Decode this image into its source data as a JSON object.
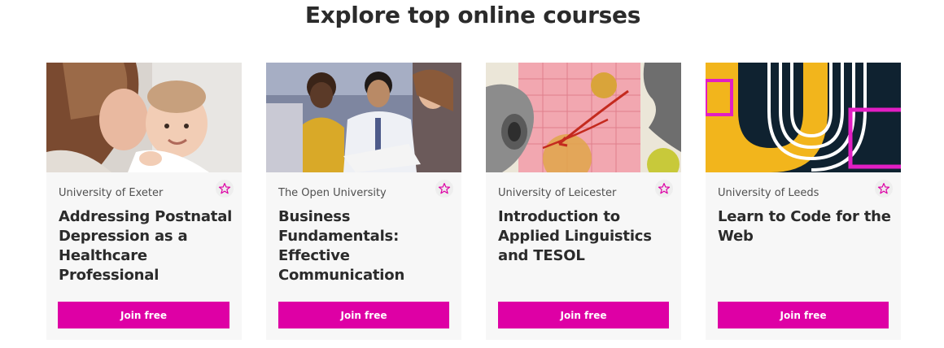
{
  "section": {
    "heading": "Explore top online courses"
  },
  "theme": {
    "accent": "#de00a5",
    "card_bg": "#f7f7f7",
    "text": "#2b2b2b"
  },
  "courses": [
    {
      "provider": "University of Exeter",
      "title": "Addressing Postnatal Depression as a Healthcare Professional",
      "cta": "Join free",
      "image": "mother-kissing-baby-photo",
      "favourite_icon": "star-outline-icon"
    },
    {
      "provider": "The Open University",
      "title": "Business Fundamentals: Effective Communication",
      "cta": "Join free",
      "image": "business-meeting-photo",
      "favourite_icon": "star-outline-icon"
    },
    {
      "provider": "University of Leicester",
      "title": "Introduction to Applied Linguistics and TESOL",
      "cta": "Join free",
      "image": "linguistics-collage-illustration",
      "favourite_icon": "star-outline-icon"
    },
    {
      "provider": "University of Leeds",
      "title": "Learn to Code for the Web",
      "cta": "Join free",
      "image": "abstract-code-shapes-illustration",
      "favourite_icon": "star-outline-icon"
    }
  ]
}
